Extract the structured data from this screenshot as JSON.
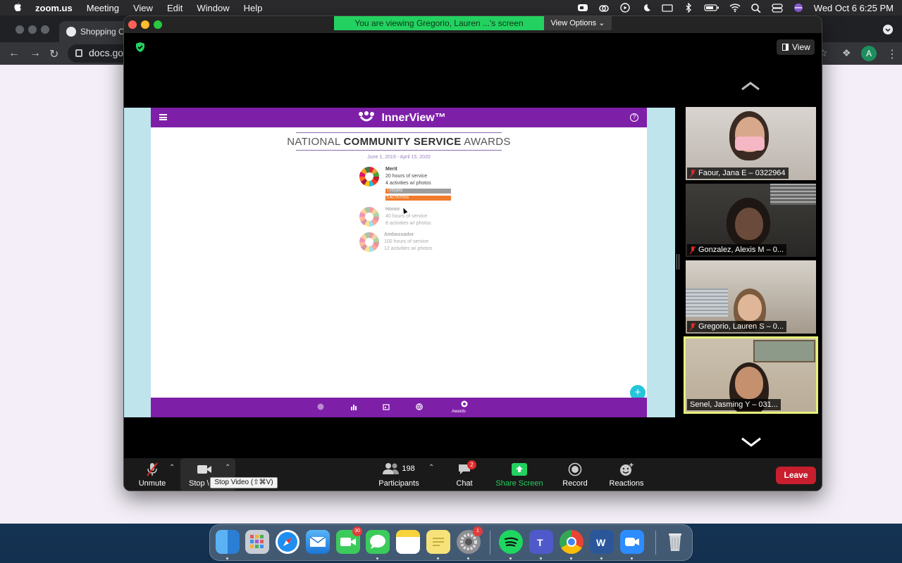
{
  "menubar": {
    "app_name": "zoom.us",
    "menus": [
      "Meeting",
      "View",
      "Edit",
      "Window",
      "Help"
    ],
    "clock": "Wed Oct 6  6:25 PM"
  },
  "browser": {
    "tab_title": "Shopping C",
    "url_fragment": "docs.go",
    "profile_initial": "A"
  },
  "zoom": {
    "viewing_banner": "You are viewing Gregorio, Lauren ...'s screen",
    "view_options": "View Options",
    "view_button": "View",
    "shared_screen": {
      "app_name": "InnerView™",
      "award_title_prefix": "NATIONAL ",
      "award_title_bold": "COMMUNITY SERVICE",
      "award_title_suffix": " AWARDS",
      "date_range": "June 1, 2019 - April 15, 2020",
      "tiers": [
        {
          "name": "Merit",
          "line1": "20 hours of service",
          "line2": "4 activities w/ photos",
          "hours_bar": "1 HOURS",
          "hours_progress": 0.05,
          "activities_bar": "5 ACTIVITIES",
          "activities_progress": 1.0
        },
        {
          "name": "Honor",
          "line1": "40 hours of service",
          "line2": "8 activities w/ photos"
        },
        {
          "name": "Ambassador",
          "line1": "100 hours of service",
          "line2": "12 activities w/ photos"
        }
      ],
      "fab_label": "+",
      "footer_active_label": "Awards"
    },
    "participants": [
      {
        "name": "Faour, Jana E – 0322964",
        "muted": true,
        "active": false
      },
      {
        "name": "Gonzalez, Alexis M – 0...",
        "muted": true,
        "active": false
      },
      {
        "name": "Gregorio, Lauren S – 0...",
        "muted": true,
        "active": false
      },
      {
        "name": "Senel, Jasming Y – 031...",
        "muted": false,
        "active": true
      }
    ],
    "toolbar": {
      "unmute": "Unmute",
      "stop_video": "Stop \\",
      "stop_video_tooltip": "Stop Video (⇧⌘V)",
      "participants_count": "198",
      "participants": "Participants",
      "chat": "Chat",
      "chat_badge": "2",
      "share_screen": "Share Screen",
      "record": "Record",
      "reactions": "Reactions",
      "leave": "Leave"
    },
    "colors": {
      "share_green": "#23d160",
      "leave_red": "#c81e2e",
      "innerview_purple": "#7e1fa8",
      "active_speaker": "#e8f07a"
    }
  },
  "dock": {
    "apps": [
      "finder-icon",
      "launchpad-icon",
      "safari-icon",
      "mail-icon",
      "facetime-icon",
      "messages-icon",
      "notes-icon",
      "stickies-icon",
      "system-preferences-icon",
      "spotify-icon",
      "teams-icon",
      "chrome-icon",
      "word-icon",
      "zoom-icon",
      "trash-icon"
    ],
    "facetime_badge": "30",
    "system_preferences_badge": "1"
  }
}
